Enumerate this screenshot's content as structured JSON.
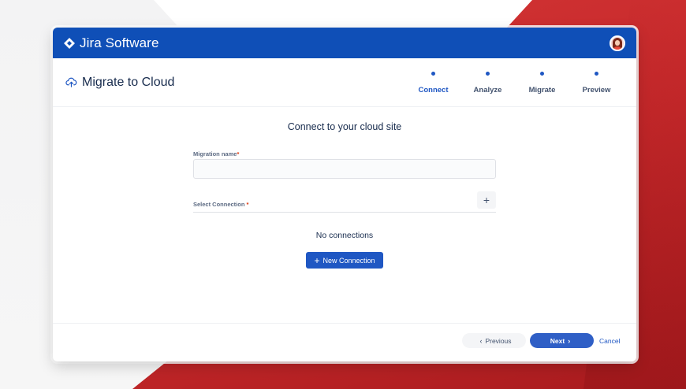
{
  "app": {
    "brand": "Jira Software",
    "brand_color": "#0f4fb7",
    "avatar_icon": "user-avatar"
  },
  "header": {
    "title": "Migrate to Cloud",
    "title_icon": "cloud-upload-icon"
  },
  "steps": [
    {
      "label": "Connect",
      "active": true
    },
    {
      "label": "Analyze",
      "active": false
    },
    {
      "label": "Migrate",
      "active": false
    },
    {
      "label": "Preview",
      "active": false
    }
  ],
  "form": {
    "title": "Connect to your cloud site",
    "migration_name_label": "Migration name",
    "migration_name_value": "",
    "select_connection_label": "Select Connection",
    "required_mark": "*",
    "add_connection_glyph": "+",
    "empty_message": "No connections",
    "new_connection_label": "New Connection",
    "new_connection_glyph": "+"
  },
  "footer": {
    "previous_label": "Previous",
    "next_label": "Next",
    "cancel_label": "Cancel",
    "prev_chevron": "‹",
    "next_chevron": "›"
  },
  "colors": {
    "accent": "#1f57c3",
    "required": "#de350b",
    "background_red": "#c5282a"
  }
}
